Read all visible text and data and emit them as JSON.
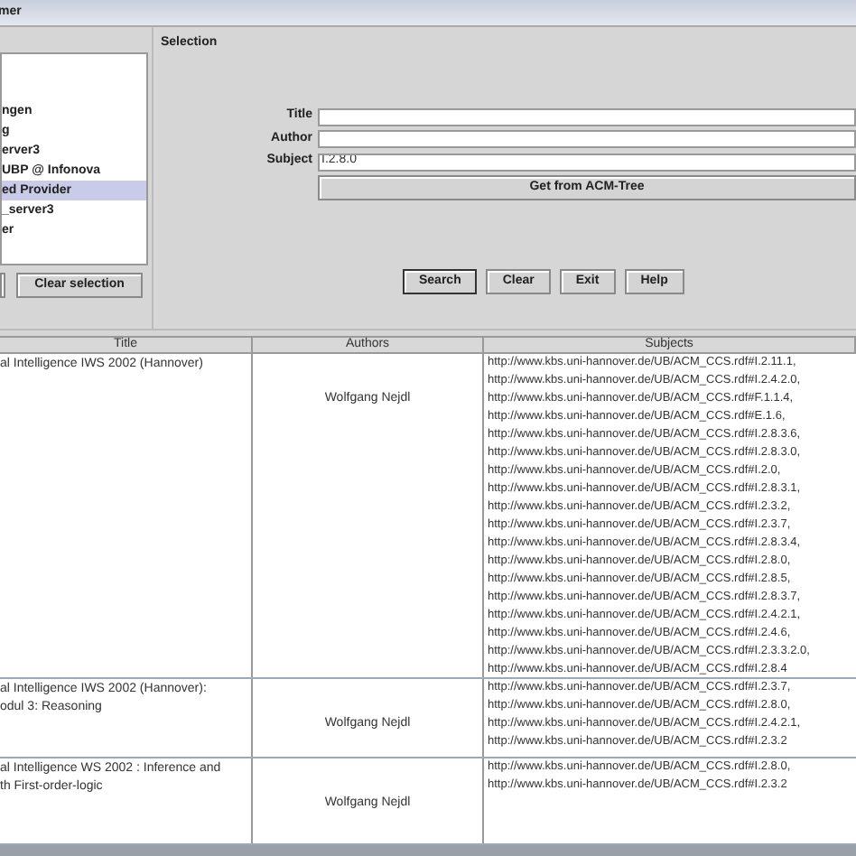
{
  "window": {
    "title": "mer"
  },
  "providers": {
    "items": [
      {
        "label": "ngen",
        "selected": false
      },
      {
        "label": "g",
        "selected": false
      },
      {
        "label": "erver3",
        "selected": false
      },
      {
        "label": "UBP @ Infonova",
        "selected": false
      },
      {
        "label": "ed Provider",
        "selected": true
      },
      {
        "label": "_server3",
        "selected": false
      },
      {
        "label": "er",
        "selected": false
      }
    ],
    "clear_button": "Clear selection"
  },
  "selection": {
    "heading": "Selection",
    "fields": [
      {
        "label": "Title"
      },
      {
        "label": "Author"
      },
      {
        "label": "Subject",
        "value": "I.2.8.0"
      }
    ],
    "acm_button": "Get from ACM-Tree",
    "buttons": [
      "Search",
      "Clear",
      "Exit",
      "Help"
    ]
  },
  "table": {
    "columns": [
      "Title",
      "Authors",
      "Subjects"
    ],
    "rows": [
      {
        "title": [
          "al Intelligence IWS 2002 (Hannover)"
        ],
        "authors": "Wolfgang Nejdl",
        "subjects": [
          "http://www.kbs.uni-hannover.de/UB/ACM_CCS.rdf#I.2.11.1,",
          "http://www.kbs.uni-hannover.de/UB/ACM_CCS.rdf#I.2.4.2.0,",
          "http://www.kbs.uni-hannover.de/UB/ACM_CCS.rdf#F.1.1.4,",
          "http://www.kbs.uni-hannover.de/UB/ACM_CCS.rdf#E.1.6,",
          "http://www.kbs.uni-hannover.de/UB/ACM_CCS.rdf#I.2.8.3.6,",
          "http://www.kbs.uni-hannover.de/UB/ACM_CCS.rdf#I.2.8.3.0,",
          "http://www.kbs.uni-hannover.de/UB/ACM_CCS.rdf#I.2.0,",
          "http://www.kbs.uni-hannover.de/UB/ACM_CCS.rdf#I.2.8.3.1,",
          "http://www.kbs.uni-hannover.de/UB/ACM_CCS.rdf#I.2.3.2,",
          "http://www.kbs.uni-hannover.de/UB/ACM_CCS.rdf#I.2.3.7,",
          "http://www.kbs.uni-hannover.de/UB/ACM_CCS.rdf#I.2.8.3.4,",
          "http://www.kbs.uni-hannover.de/UB/ACM_CCS.rdf#I.2.8.0,",
          "http://www.kbs.uni-hannover.de/UB/ACM_CCS.rdf#I.2.8.5,",
          "http://www.kbs.uni-hannover.de/UB/ACM_CCS.rdf#I.2.8.3.7,",
          "http://www.kbs.uni-hannover.de/UB/ACM_CCS.rdf#I.2.4.2.1,",
          "http://www.kbs.uni-hannover.de/UB/ACM_CCS.rdf#I.2.4.6,",
          "http://www.kbs.uni-hannover.de/UB/ACM_CCS.rdf#I.2.3.3.2.0,",
          "http://www.kbs.uni-hannover.de/UB/ACM_CCS.rdf#I.2.8.4"
        ]
      },
      {
        "title": [
          "al Intelligence IWS 2002 (Hannover):",
          "odul 3: Reasoning"
        ],
        "authors": "Wolfgang Nejdl",
        "subjects": [
          "http://www.kbs.uni-hannover.de/UB/ACM_CCS.rdf#I.2.3.7,",
          "http://www.kbs.uni-hannover.de/UB/ACM_CCS.rdf#I.2.8.0,",
          "http://www.kbs.uni-hannover.de/UB/ACM_CCS.rdf#I.2.4.2.1,",
          "http://www.kbs.uni-hannover.de/UB/ACM_CCS.rdf#I.2.3.2"
        ]
      },
      {
        "title": [
          "al Intelligence WS 2002 : Inference and",
          "th First-order-logic"
        ],
        "authors": "Wolfgang Nejdl",
        "subjects": [
          "http://www.kbs.uni-hannover.de/UB/ACM_CCS.rdf#I.2.8.0,",
          "http://www.kbs.uni-hannover.de/UB/ACM_CCS.rdf#I.2.3.2"
        ]
      }
    ]
  }
}
